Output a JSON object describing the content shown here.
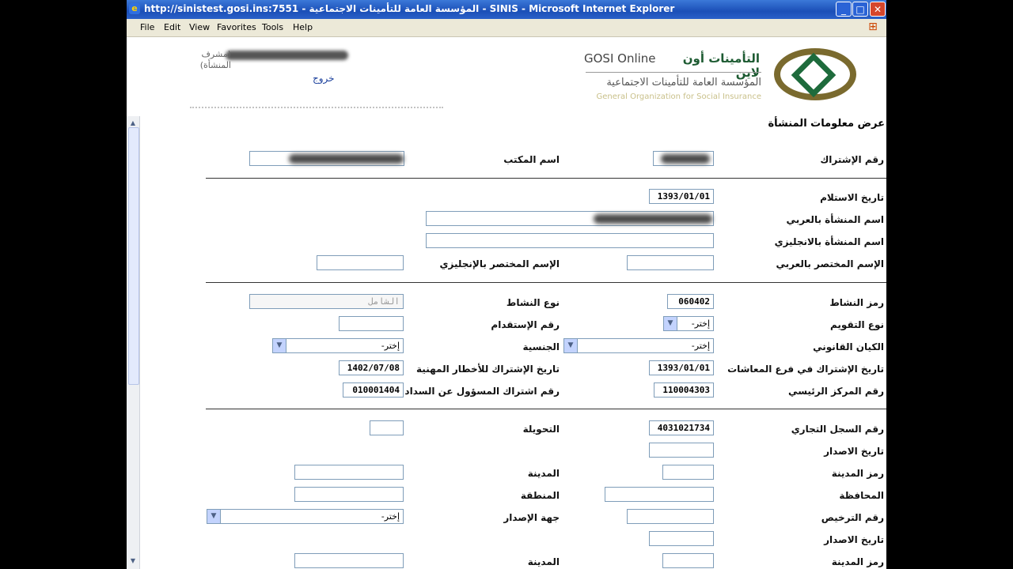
{
  "window": {
    "title": "http://sinistest.gosi.ins:7551 - المؤسسة العامة للتأمينات الاجتماعية - SINIS - Microsoft Internet Explorer",
    "controls": {
      "minimize": "_",
      "maximize": "□",
      "close": "✕"
    }
  },
  "menu": [
    "File",
    "Edit",
    "View",
    "Favorites",
    "Tools",
    "Help"
  ],
  "header": {
    "brand_ar": "التأمينات أون لاين",
    "brand_en": "GOSI Online",
    "org_ar": "المؤسسة العامة للتأمينات الاجتماعية",
    "org_en": "General Organization for Social Insurance",
    "user_role": "(مشرف المنشأة)",
    "logout": "خروج"
  },
  "page": {
    "title": "عرض معلومات المنشأة",
    "labels": {
      "subscription_no": "رقم الإشتراك",
      "office_name": "اسم المكتب",
      "receipt_date": "تاريخ الاستلام",
      "name_ar": "اسم المنشأة بالعربي",
      "name_en": "اسم المنشأة بالانجليزي",
      "short_ar": "الإسم المختصر بالعربي",
      "short_en": "الإسم المختصر بالإنجليزي",
      "activity_code": "رمز النشاط",
      "activity_type": "نوع النشاط",
      "rating_type": "نوع التقويم",
      "employment_no": "رقم الإستقدام",
      "legal_entity": "الكيان القانوني",
      "nationality": "الجنسية",
      "pension_date": "تاريخ الإشتراك في فرع المعاشات",
      "hazard_date": "تاريخ الإشتراك للأخطار المهنية",
      "main_center": "رقم المركز الرئيسي",
      "payer_no": "رقم اشتراك المسؤول عن السداد",
      "cr_no": "رقم السجل التجاري",
      "transfer": "التحويلة",
      "issue_date": "تاريخ الاصدار",
      "city_code": "رمز المدينة",
      "city": "المدينة",
      "governorate": "المحافظة",
      "region": "المنطقة",
      "license_no": "رقم الترخيص",
      "issuer": "جهة الإصدار",
      "issue_date_2": "تاريخ الاصدار",
      "city_code_2": "رمز المدينة",
      "city_2": "المدينة"
    },
    "values": {
      "receipt_date": "1393/01/01",
      "activity_code": "060402",
      "activity_type": "الشامل",
      "rating_type": "إختر-",
      "legal_entity": "إختر-",
      "nationality": "إختر-",
      "pension_date": "1393/01/01",
      "hazard_date": "1402/07/08",
      "main_center": "110004303",
      "payer_no": "010001404",
      "cr_no": "4031021734",
      "issuer": "إختر-"
    }
  }
}
